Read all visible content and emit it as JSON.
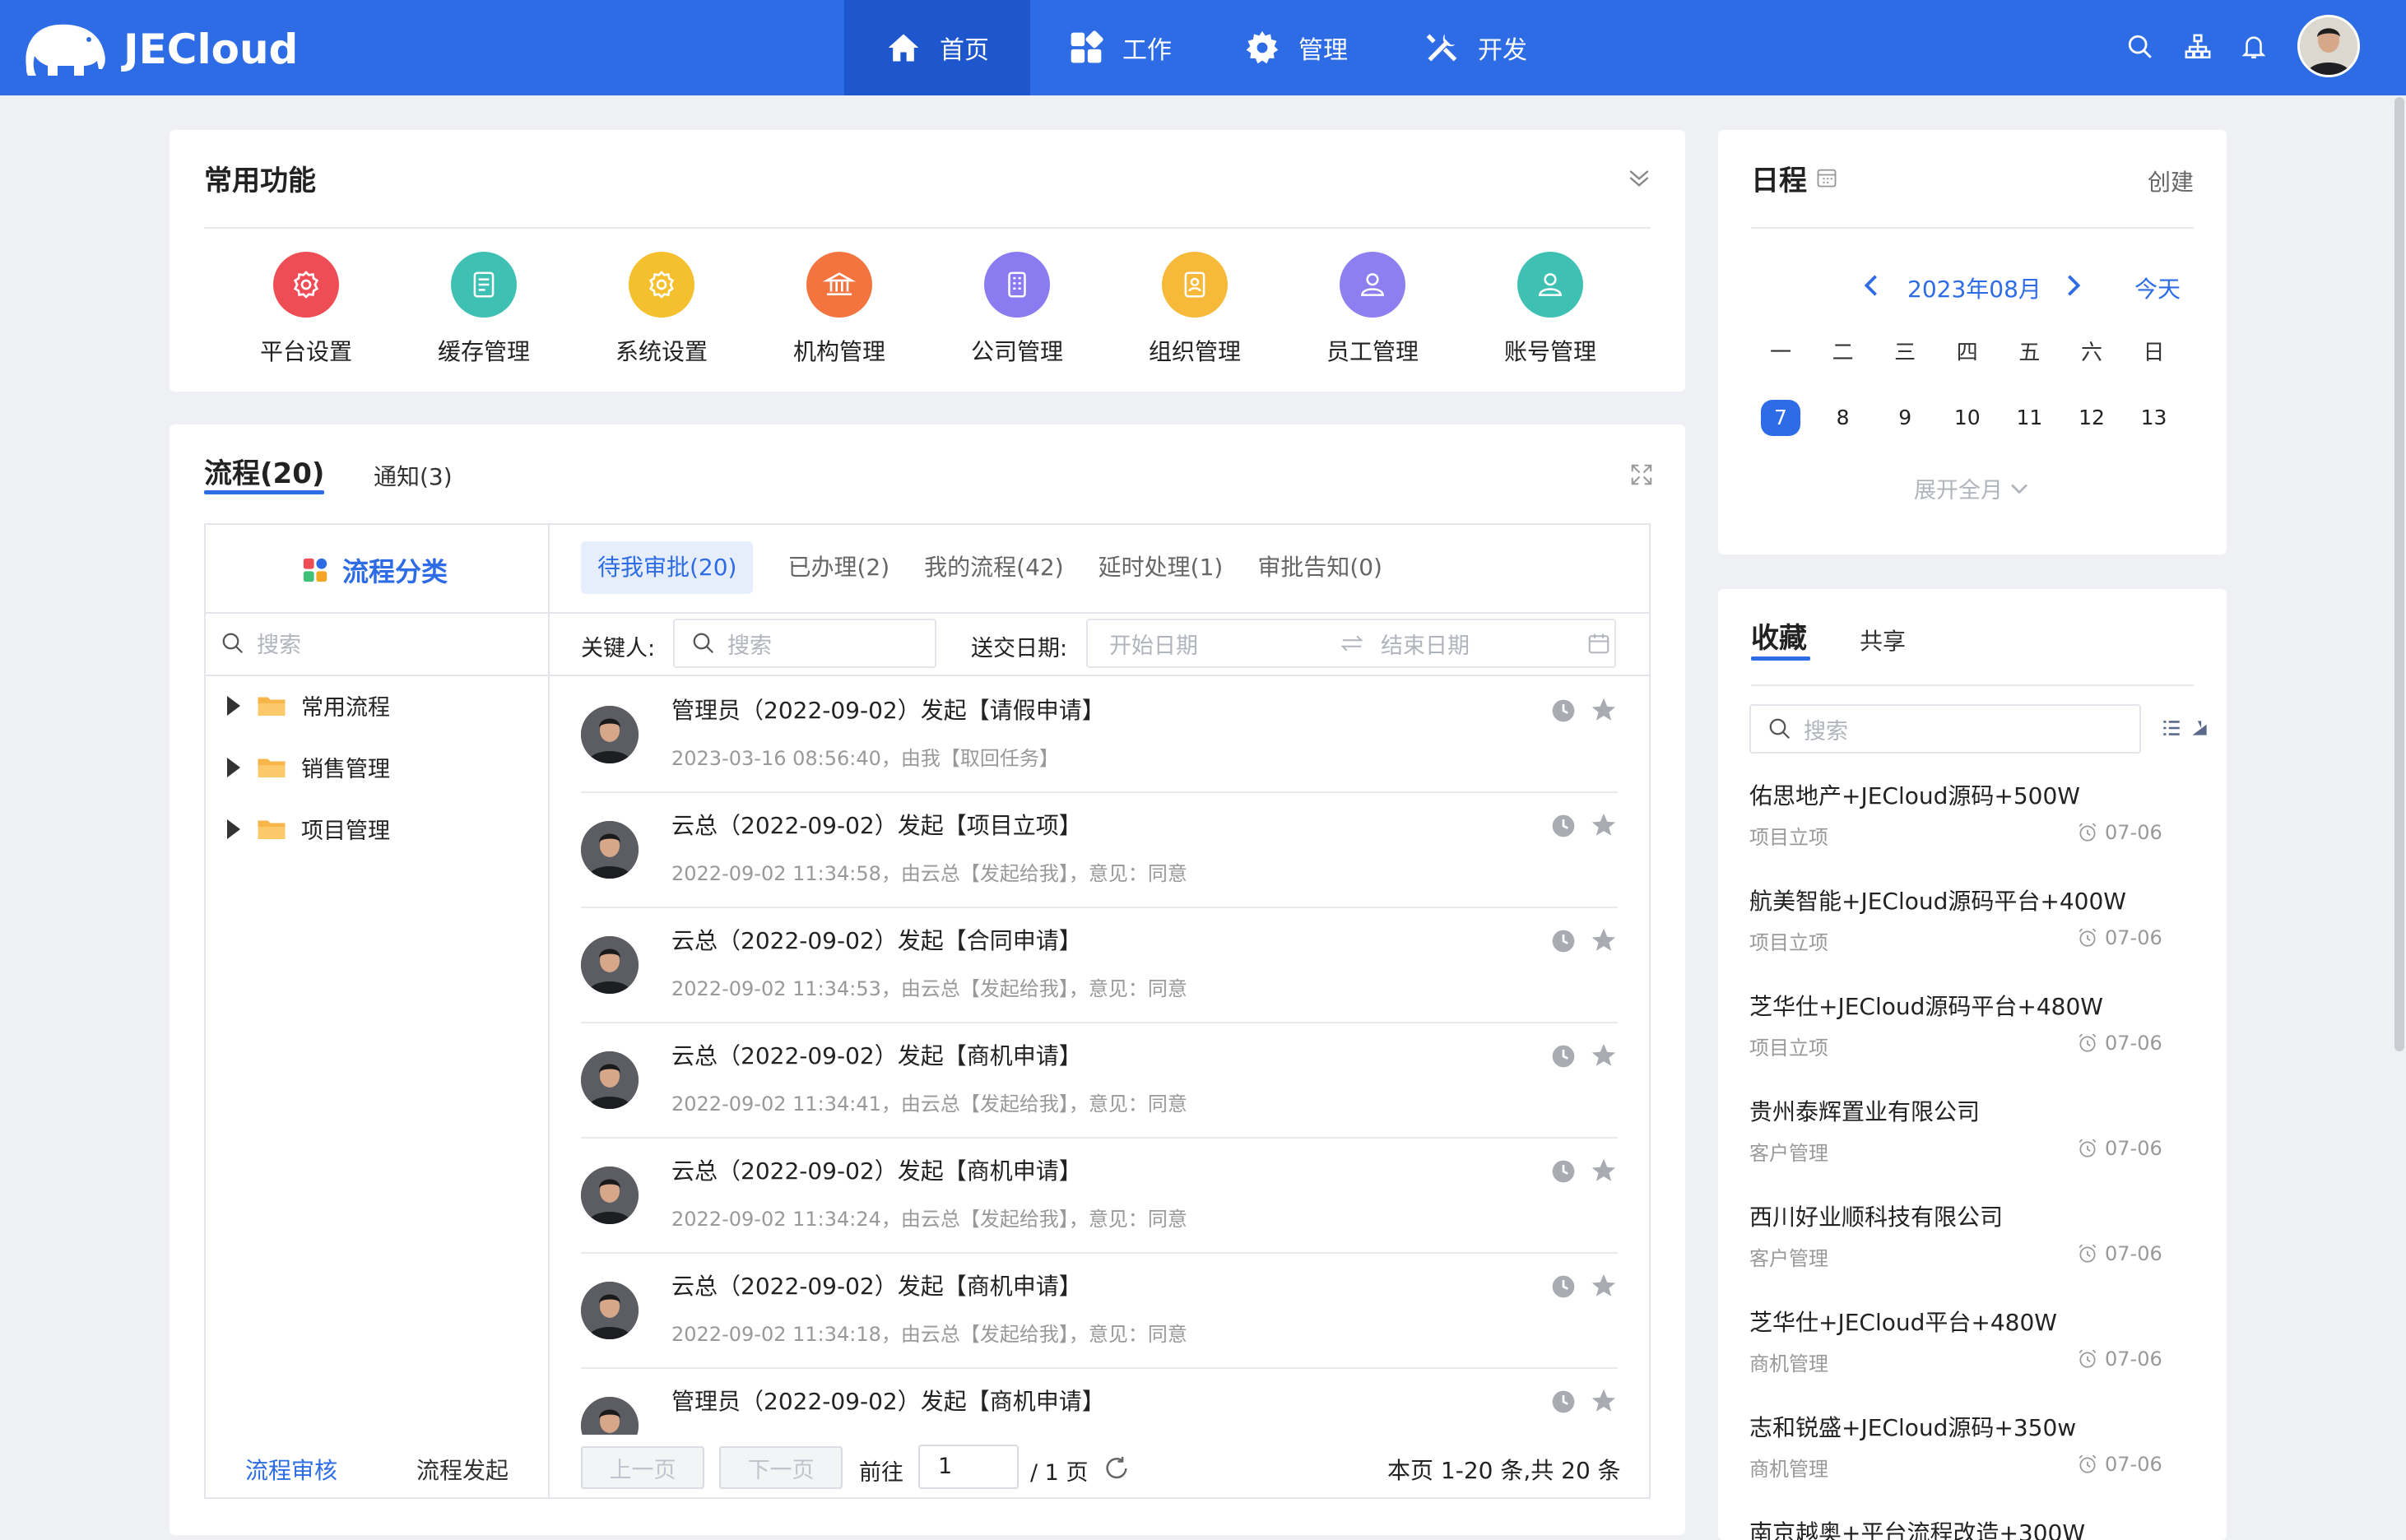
{
  "brand": {
    "name": "JECloud"
  },
  "nav": {
    "items": [
      {
        "label": "首页",
        "icon": "home-icon"
      },
      {
        "label": "工作",
        "icon": "apps-icon"
      },
      {
        "label": "管理",
        "icon": "gear-icon"
      },
      {
        "label": "开发",
        "icon": "tools-icon"
      }
    ]
  },
  "common": {
    "title": "常用功能",
    "items": [
      {
        "label": "平台设置",
        "icon": "gear-icon",
        "color": "#ef4d55"
      },
      {
        "label": "缓存管理",
        "icon": "note-icon",
        "color": "#3ec1b3"
      },
      {
        "label": "系统设置",
        "icon": "gear-icon",
        "color": "#f5c02e"
      },
      {
        "label": "机构管理",
        "icon": "bank-icon",
        "color": "#f3743f"
      },
      {
        "label": "公司管理",
        "icon": "building-icon",
        "color": "#8a7cf0"
      },
      {
        "label": "组织管理",
        "icon": "contact-icon",
        "color": "#f7b93a"
      },
      {
        "label": "员工管理",
        "icon": "user-icon",
        "color": "#8d7ff0"
      },
      {
        "label": "账号管理",
        "icon": "user-icon",
        "color": "#3ec1b3"
      }
    ]
  },
  "flow": {
    "tab_main": "流程(20)",
    "tab_notice": "通知(3)",
    "category_title": "流程分类",
    "search_placeholder": "搜索",
    "tree": [
      "常用流程",
      "销售管理",
      "项目管理"
    ],
    "footer_left": "流程审核",
    "footer_right": "流程发起",
    "sub_tabs": [
      "待我审批(20)",
      "已办理(2)",
      "我的流程(42)",
      "延时处理(1)",
      "审批告知(0)"
    ],
    "keyword_label": "关键人:",
    "keyword_placeholder": "搜索",
    "date_label": "送交日期:",
    "date_start": "开始日期",
    "date_end": "结束日期",
    "items": [
      {
        "title": "管理员（2022-09-02）发起【请假申请】",
        "sub": "2023-03-16 08:56:40，由我【取回任务】"
      },
      {
        "title": "云总（2022-09-02）发起【项目立项】",
        "sub": "2022-09-02 11:34:58，由云总【发起给我】，意见：同意"
      },
      {
        "title": "云总（2022-09-02）发起【合同申请】",
        "sub": "2022-09-02 11:34:53，由云总【发起给我】，意见：同意"
      },
      {
        "title": "云总（2022-09-02）发起【商机申请】",
        "sub": "2022-09-02 11:34:41，由云总【发起给我】，意见：同意"
      },
      {
        "title": "云总（2022-09-02）发起【商机申请】",
        "sub": "2022-09-02 11:34:24，由云总【发起给我】，意见：同意"
      },
      {
        "title": "云总（2022-09-02）发起【商机申请】",
        "sub": "2022-09-02 11:34:18，由云总【发起给我】，意见：同意"
      },
      {
        "title": "管理员（2022-09-02）发起【商机申请】",
        "sub": ""
      }
    ],
    "pager": {
      "prev": "上一页",
      "next": "下一页",
      "goto": "前往",
      "page_value": "1",
      "total_pages": "/ 1 页",
      "summary": "本页 1-20 条,共 20 条"
    }
  },
  "calendar": {
    "title": "日程",
    "create": "创建",
    "month": "2023年08月",
    "today_btn": "今天",
    "weekdays": [
      "一",
      "二",
      "三",
      "四",
      "五",
      "六",
      "日"
    ],
    "days": [
      "7",
      "8",
      "9",
      "10",
      "11",
      "12",
      "13"
    ],
    "expand": "展开全月"
  },
  "favorites": {
    "tab_fav": "收藏",
    "tab_share": "共享",
    "search_placeholder": "搜索",
    "items": [
      {
        "title": "佑思地产+JECloud源码+500W",
        "cat": "项目立项",
        "date": "07-06"
      },
      {
        "title": "航美智能+JECloud源码平台+400W",
        "cat": "项目立项",
        "date": "07-06"
      },
      {
        "title": "芝华仕+JECloud源码平台+480W",
        "cat": "项目立项",
        "date": "07-06"
      },
      {
        "title": "贵州泰辉置业有限公司",
        "cat": "客户管理",
        "date": "07-06"
      },
      {
        "title": "西川好业顺科技有限公司",
        "cat": "客户管理",
        "date": "07-06"
      },
      {
        "title": "芝华仕+JECloud平台+480W",
        "cat": "商机管理",
        "date": "07-06"
      },
      {
        "title": "志和锐盛+JECloud源码+350w",
        "cat": "商机管理",
        "date": "07-06"
      },
      {
        "title": "南京越奥+平台流程改造+300W",
        "cat": "",
        "date": ""
      }
    ]
  }
}
